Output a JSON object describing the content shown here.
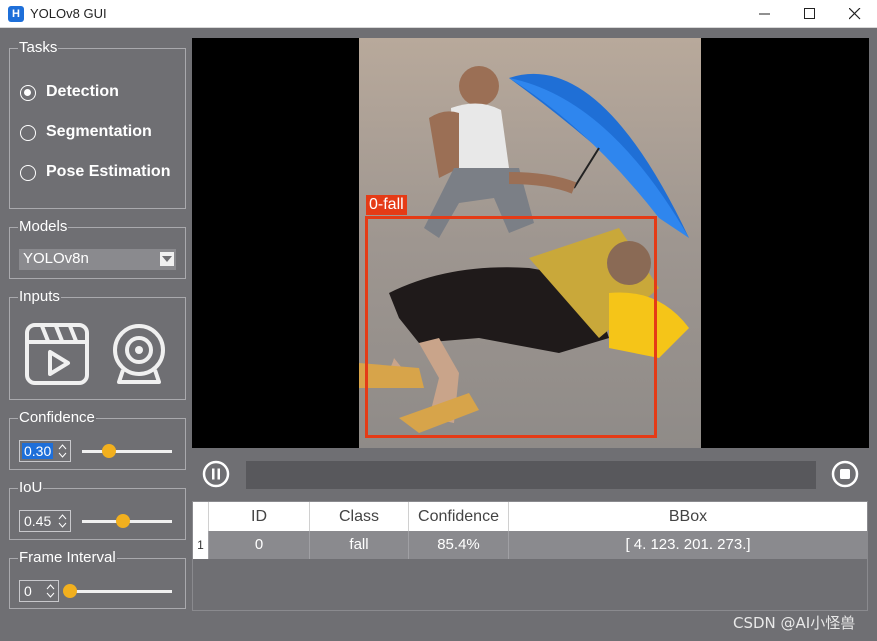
{
  "window": {
    "title": "YOLOv8 GUI",
    "icon_letter": "H"
  },
  "tasks": {
    "title": "Tasks",
    "options": [
      {
        "label": "Detection",
        "checked": true
      },
      {
        "label": "Segmentation",
        "checked": false
      },
      {
        "label": "Pose Estimation",
        "checked": false
      }
    ]
  },
  "models": {
    "title": "Models",
    "selected": "YOLOv8n"
  },
  "inputs": {
    "title": "Inputs",
    "icons": [
      "video-file-icon",
      "webcam-icon"
    ]
  },
  "confidence": {
    "title": "Confidence",
    "value": "0.30",
    "slider_fraction": 0.3
  },
  "iou": {
    "title": "IoU",
    "value": "0.45",
    "slider_fraction": 0.45
  },
  "frame_interval": {
    "title": "Frame Interval",
    "value": "0",
    "slider_fraction": 0.0
  },
  "detection": {
    "label": "0-fall"
  },
  "table": {
    "headers": [
      "ID",
      "Class",
      "Confidence",
      "BBox"
    ],
    "rows": [
      {
        "row_number": "1",
        "id": "0",
        "class": "fall",
        "confidence": "85.4%",
        "bbox": "[  4. 123. 201. 273.]"
      }
    ]
  },
  "watermark": "CSDN @AI小怪兽",
  "colors": {
    "accent": "#f2b01e",
    "bbox": "#e53b16",
    "selection": "#1e6fd9",
    "panel": "#6f6f73"
  }
}
